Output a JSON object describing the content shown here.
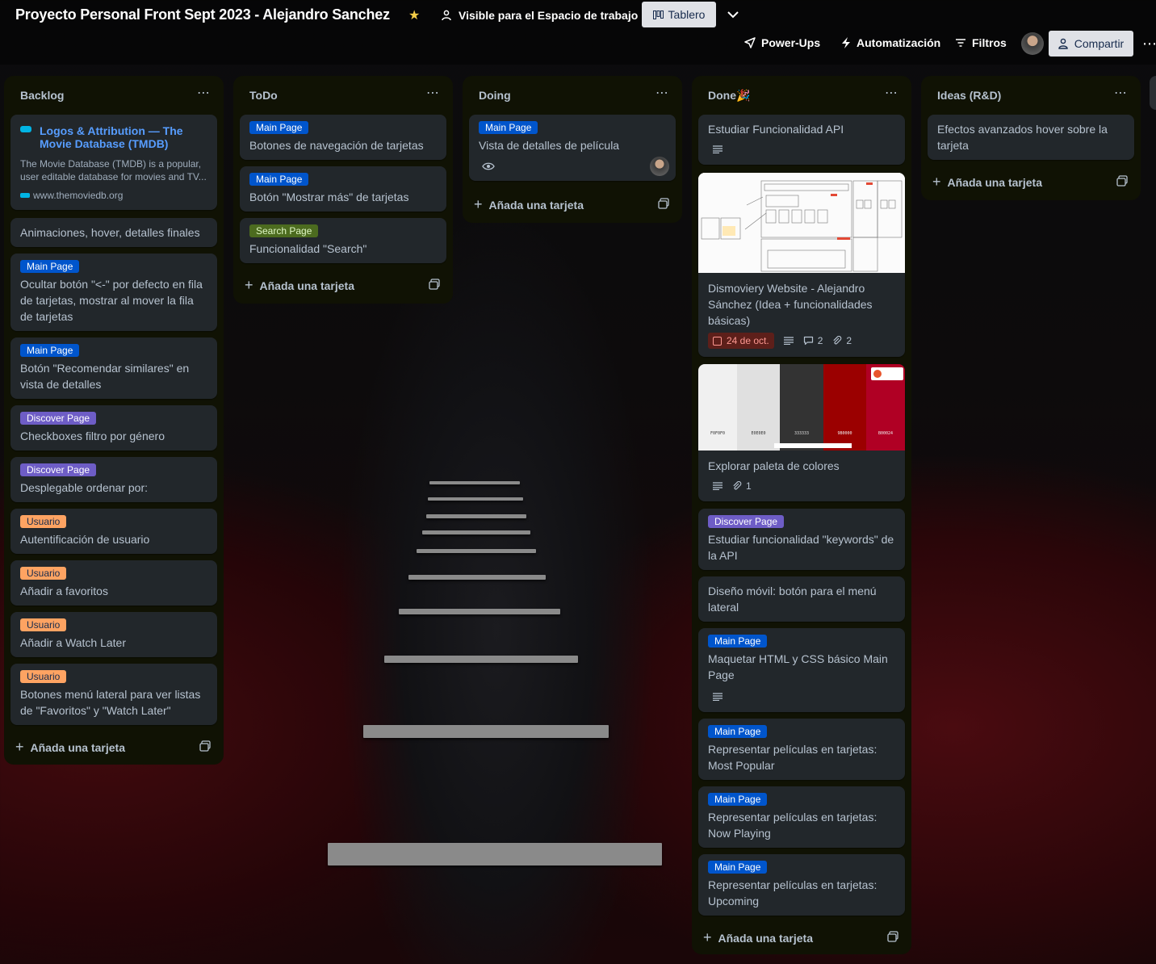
{
  "header": {
    "board_title": "Proyecto Personal Front Sept 2023 - Alejandro Sanchez",
    "visibility": "Visible para el Espacio de trabajo",
    "view": "Tablero",
    "power_ups": "Power-Ups",
    "automation": "Automatización",
    "filters": "Filtros",
    "share": "Compartir"
  },
  "labels": {
    "main": "Main Page",
    "discover": "Discover Page",
    "search": "Search Page",
    "user": "Usuario"
  },
  "add_card": "Añada una tarjeta",
  "lists": [
    {
      "title": "Backlog",
      "cards": [
        {
          "title": "Logos & Attribution — The Movie Database (TMDB)",
          "desc": "The Movie Database (TMDB) is a popular, user editable database for movies and TV...",
          "url": "www.themoviedb.org"
        },
        {
          "text": "Animaciones, hover, detalles finales"
        },
        {
          "label": "Main Page",
          "text": "Ocultar botón \"<-\" por defecto en fila de tarjetas, mostrar al mover la fila de tarjetas"
        },
        {
          "label": "Main Page",
          "text": "Botón \"Recomendar similares\" en vista de detalles"
        },
        {
          "label": "Discover Page",
          "text": "Checkboxes filtro por género"
        },
        {
          "label": "Discover Page",
          "text": "Desplegable ordenar por:"
        },
        {
          "label": "Usuario",
          "text": "Autentificación de usuario"
        },
        {
          "label": "Usuario",
          "text": "Añadir a favoritos"
        },
        {
          "label": "Usuario",
          "text": "Añadir a Watch Later"
        },
        {
          "label": "Usuario",
          "text": "Botones menú lateral para ver listas de \"Favoritos\" y \"Watch Later\""
        }
      ]
    },
    {
      "title": "ToDo",
      "cards": [
        {
          "label": "Main Page",
          "text": "Botones de navegación de tarjetas"
        },
        {
          "label": "Main Page",
          "text": "Botón \"Mostrar más\" de tarjetas"
        },
        {
          "label": "Search Page",
          "text": "Funcionalidad \"Search\""
        }
      ]
    },
    {
      "title": "Doing",
      "cards": [
        {
          "label": "Main Page",
          "text": "Vista de detalles de película"
        }
      ]
    },
    {
      "title": "Done🎉",
      "cards": [
        {
          "text": "Estudiar Funcionalidad API"
        },
        {
          "text": "Dismoviery Website - Alejandro Sánchez (Idea + funcionalidades básicas)",
          "date": "24 de oct.",
          "comments": "2",
          "attachments": "2"
        },
        {
          "text": "Explorar paleta de colores",
          "attachments": "1",
          "palette": [
            "F0F0F0",
            "E0E0E0",
            "333333",
            "9B0000",
            "B00024"
          ]
        },
        {
          "label": "Discover Page",
          "text": "Estudiar funcionalidad \"keywords\" de la API"
        },
        {
          "text": "Diseño móvil: botón para el menú lateral"
        },
        {
          "label": "Main Page",
          "text": "Maquetar HTML y CSS básico Main Page"
        },
        {
          "label": "Main Page",
          "text": "Representar películas en tarjetas: Most Popular"
        },
        {
          "label": "Main Page",
          "text": "Representar películas en tarjetas: Now Playing"
        },
        {
          "label": "Main Page",
          "text": "Representar películas en tarjetas: Upcoming"
        }
      ]
    },
    {
      "title": "Ideas (R&D)",
      "cards": [
        {
          "text": "Efectos avanzados hover sobre la tarjeta"
        }
      ]
    }
  ],
  "colors": {
    "list_bg": "#101204",
    "card_bg": "#22272b",
    "text": "#b6c2cf",
    "main_label": "#0055cc",
    "discover_label": "#6e5dc6",
    "search_label": "#4c6b1f",
    "user_label": "#fea362",
    "link": "#579dff",
    "due_badge": "#5d1f1a"
  }
}
